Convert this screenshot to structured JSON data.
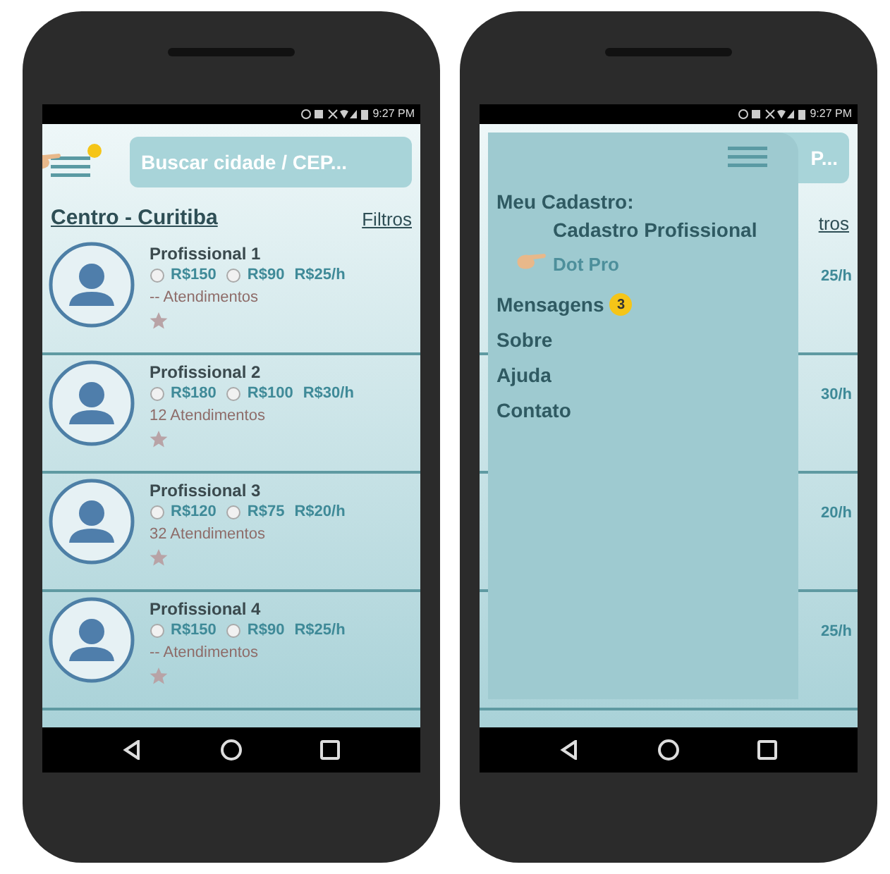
{
  "phones": [
    {
      "kind": "list",
      "status_time": "9:27 PM",
      "menu_badge": true,
      "pointer": true,
      "search": {
        "placeholder": "Buscar cidade / CEP..."
      },
      "location": "Centro - Curitiba",
      "filter": "Filtros",
      "professionals": [
        {
          "name": "Profissional 1",
          "prices": [
            "R$150",
            "R$90",
            "R$25/h"
          ],
          "visits": "-- Atendimentos"
        },
        {
          "name": "Profissional 2",
          "prices": [
            "R$180",
            "R$100",
            "R$30/h"
          ],
          "visits": "12 Atendimentos"
        },
        {
          "name": "Profissional 3",
          "prices": [
            "R$120",
            "R$75",
            "R$20/h"
          ],
          "visits": "32 Atendimentos"
        },
        {
          "name": "Profissional 4",
          "prices": [
            "R$150",
            "R$90",
            "R$25/h"
          ],
          "visits": "-- Atendimentos"
        }
      ]
    },
    {
      "kind": "menu",
      "status_time": "9:27 PM",
      "search": {
        "value": "P..."
      },
      "behind": [
        "tros",
        "25/h",
        "30/h",
        "20/h",
        "25/h"
      ],
      "menu": [
        {
          "label": "Meu Cadastro:",
          "children": [
            {
              "label": "Cadastro Profissional",
              "kind": "text"
            },
            {
              "label": "Dot Pro",
              "kind": "link",
              "pointer": true
            }
          ]
        },
        {
          "label": "Mensagens",
          "badge": "3"
        },
        {
          "label": "Sobre"
        },
        {
          "label": "Ajuda"
        },
        {
          "label": "Contato"
        }
      ]
    }
  ]
}
